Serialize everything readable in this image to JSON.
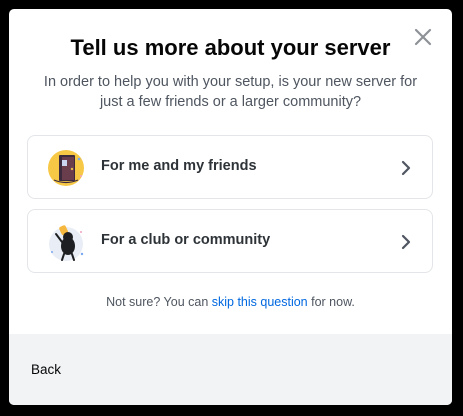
{
  "modal": {
    "title": "Tell us more about your server",
    "subtitle": "In order to help you with your setup, is your new server for just a few friends or a larger community?",
    "close_icon": "close-icon",
    "options": [
      {
        "label": "For me and my friends",
        "icon": "friends-door-illustration"
      },
      {
        "label": "For a club or community",
        "icon": "club-community-illustration"
      }
    ],
    "hint": {
      "prefix": "Not sure? You can ",
      "link": "skip this question",
      "suffix": " for now."
    },
    "footer": {
      "back_label": "Back"
    }
  }
}
